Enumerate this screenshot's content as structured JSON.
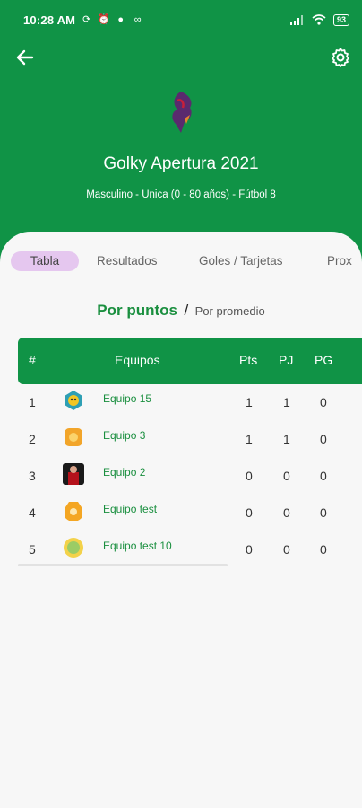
{
  "status_bar": {
    "time": "10:28 AM",
    "battery": "93"
  },
  "header": {
    "title": "Golky Apertura 2021",
    "subtitle": "Masculino - Unica (0 - 80 años) - Fútbol 8",
    "colors": {
      "primary": "#109346",
      "text": "#ffffff"
    }
  },
  "tabs": [
    {
      "label": "Tabla",
      "active": true
    },
    {
      "label": "Resultados",
      "active": false
    },
    {
      "label": "Goles / Tarjetas",
      "active": false
    },
    {
      "label": "Prox",
      "active": false
    }
  ],
  "standings_mode": {
    "selected": "Por puntos",
    "separator": "/",
    "other": "Por promedio"
  },
  "table": {
    "headers": {
      "position": "#",
      "team": "Equipos",
      "points": "Pts",
      "played": "PJ",
      "won": "PG"
    },
    "rows": [
      {
        "position": "1",
        "team": "Equipo 15",
        "pts": "1",
        "pj": "1",
        "pg": "0",
        "badge_color": "#2e9fb4"
      },
      {
        "position": "2",
        "team": "Equipo 3",
        "pts": "1",
        "pj": "1",
        "pg": "0",
        "badge_color": "#f2a52a"
      },
      {
        "position": "3",
        "team": "Equipo 2",
        "pts": "0",
        "pj": "0",
        "pg": "0",
        "badge_color": "#b5121b"
      },
      {
        "position": "4",
        "team": "Equipo test",
        "pts": "0",
        "pj": "0",
        "pg": "0",
        "badge_color": "#f4a623"
      },
      {
        "position": "5",
        "team": "Equipo test 10",
        "pts": "0",
        "pj": "0",
        "pg": "0",
        "badge_color": "#9ccc65"
      }
    ]
  },
  "accent_colors": {
    "green_text": "#1a8f3f",
    "active_tab_bg": "#e5c7ef"
  }
}
